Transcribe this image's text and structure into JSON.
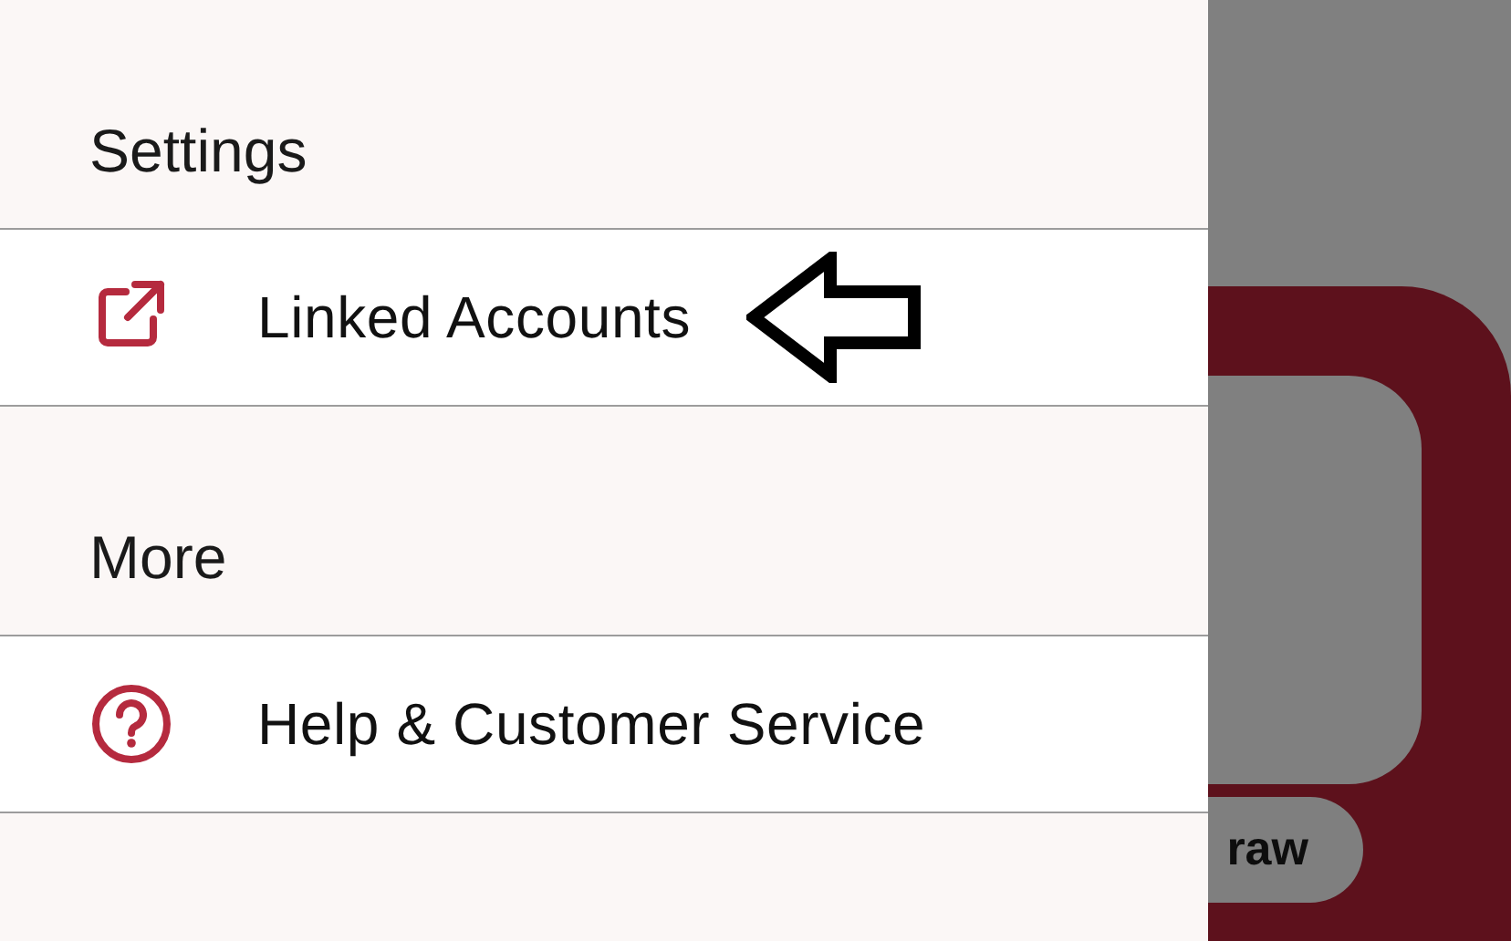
{
  "drawer": {
    "sections": [
      {
        "title": "Settings",
        "items": [
          {
            "label": "Linked Accounts",
            "kind": "link"
          }
        ]
      },
      {
        "title": "More",
        "items": [
          {
            "label": "Help & Customer Service",
            "kind": "help"
          }
        ]
      }
    ]
  },
  "background": {
    "button": "raw"
  }
}
